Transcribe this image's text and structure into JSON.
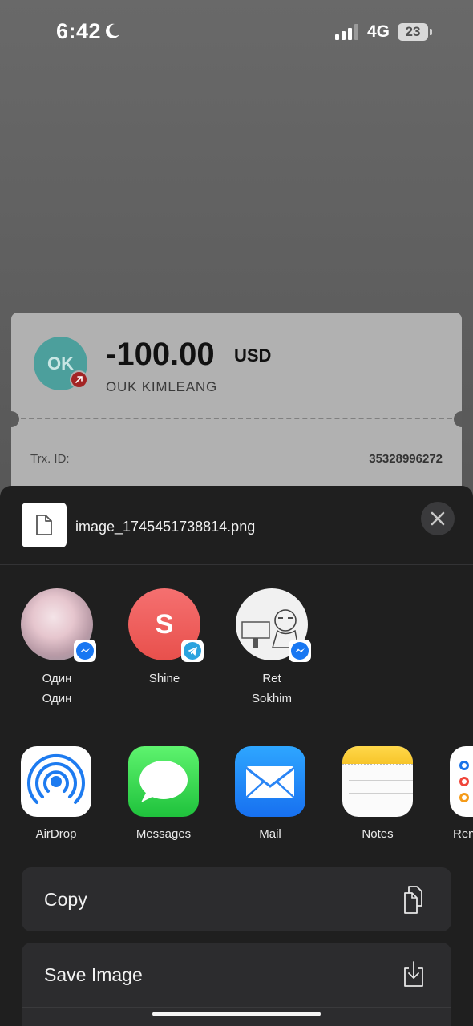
{
  "status_bar": {
    "time": "6:42",
    "network": "4G",
    "battery": "23"
  },
  "receipt": {
    "avatar_initials": "OK",
    "amount": "-100.00",
    "currency": "USD",
    "recipient": "OUK KIMLEANG",
    "trx_label": "Trx. ID:",
    "trx_value": "35328996272"
  },
  "share_sheet": {
    "file_name": "image_1745451738814.png",
    "contacts": [
      {
        "line1": "Один",
        "line2": "Один",
        "app": "messenger"
      },
      {
        "line1": "Shine",
        "line2": "",
        "initial": "S",
        "app": "telegram"
      },
      {
        "line1": "Ret",
        "line2": "Sokhim",
        "app": "messenger"
      }
    ],
    "apps": [
      {
        "label": "AirDrop"
      },
      {
        "label": "Messages"
      },
      {
        "label": "Mail"
      },
      {
        "label": "Notes"
      },
      {
        "label": "Ren"
      }
    ],
    "actions": [
      {
        "label": "Copy",
        "icon": "copy-icon"
      },
      {
        "label": "Save Image",
        "icon": "save-image-icon"
      }
    ]
  },
  "colors": {
    "receipt_avatar": "#4c9f9c",
    "outgoing_badge": "#a32424",
    "messenger": "#1877f2",
    "telegram": "#2aa3df",
    "shine_avatar": "#f0605a"
  }
}
